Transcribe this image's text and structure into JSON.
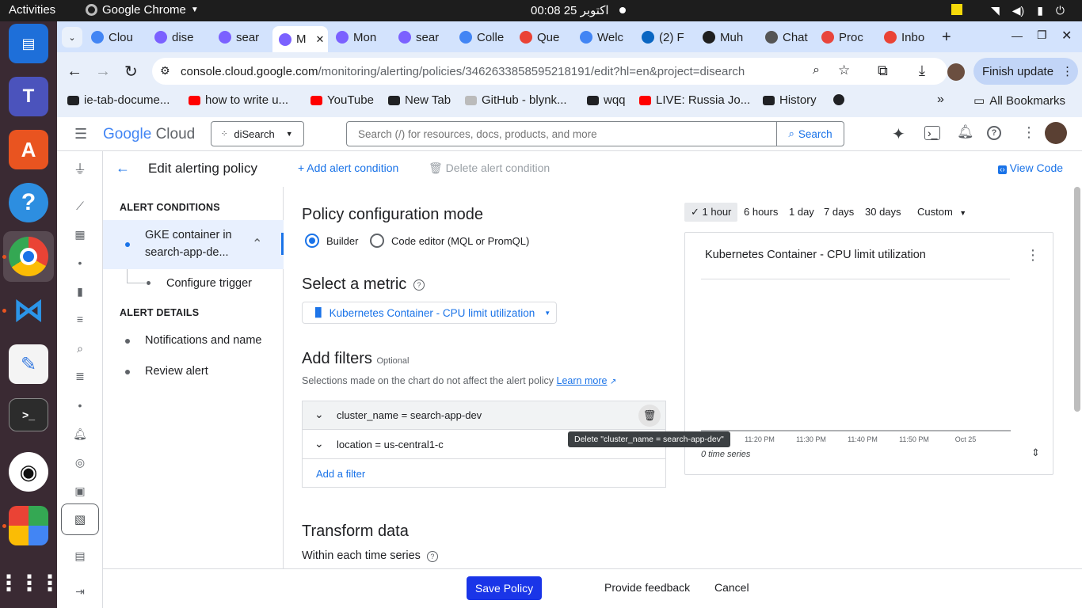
{
  "os": {
    "activities": "Activities",
    "app_name": "Google Chrome",
    "clock": "00:08  25 اکتوبر"
  },
  "browser": {
    "tabs": [
      {
        "label": "Clou",
        "color": "#4285f4"
      },
      {
        "label": "dise",
        "color": "#7b61ff"
      },
      {
        "label": "sear",
        "color": "#7b61ff"
      },
      {
        "label": "M",
        "color": "#7b61ff"
      },
      {
        "label": "Mon",
        "color": "#7b61ff"
      },
      {
        "label": "sear",
        "color": "#7b61ff"
      },
      {
        "label": "Colle",
        "color": "#4285f4"
      },
      {
        "label": "Que",
        "color": "#ea4335"
      },
      {
        "label": "Welc",
        "color": "#4285f4"
      },
      {
        "label": "(2) F",
        "color": "#0a66c2"
      },
      {
        "label": "Muh",
        "color": "#1f1f1f"
      },
      {
        "label": "Chat",
        "color": "#555555"
      },
      {
        "label": "Proc",
        "color": "#e8453c"
      },
      {
        "label": "Inbo",
        "color": "#ea4335"
      }
    ],
    "url_host": "console.cloud.google.com",
    "url_path": "/monitoring/alerting/policies/3462633858595218191/edit?hl=en&project=disearch",
    "finish_update": "Finish update",
    "bookmarks": [
      "ie-tab-docume...",
      "how to write u...",
      "YouTube",
      "New Tab",
      "GitHub - blynk...",
      "wqq",
      "LIVE: Russia Jo...",
      "History"
    ],
    "all_bookmarks": "All Bookmarks"
  },
  "gcp": {
    "logo_google": "Google",
    "logo_cloud": "Cloud",
    "project": "diSearch",
    "search_placeholder": "Search (/) for resources, docs, products, and more",
    "search_button": "Search"
  },
  "header": {
    "title": "Edit alerting policy",
    "add_condition": "Add alert condition",
    "delete_condition": "Delete alert condition",
    "view_code": "View Code"
  },
  "leftnav": {
    "alert_conditions": "ALERT CONDITIONS",
    "condition_line1": "GKE container in",
    "condition_line2": "search-app-de...",
    "configure_trigger": "Configure trigger",
    "alert_details": "ALERT DETAILS",
    "notifications": "Notifications and name",
    "review": "Review alert"
  },
  "main": {
    "mode_title": "Policy configuration mode",
    "builder": "Builder",
    "code_editor": "Code editor (MQL or PromQL)",
    "metric_title": "Select a metric",
    "metric_value": "Kubernetes Container - CPU limit utilization",
    "filters_title": "Add filters",
    "filters_optional": "Optional",
    "filters_note": "Selections made on the chart do not affect the alert policy",
    "learn_more": "Learn more",
    "filters": [
      "cluster_name = search-app-dev",
      "location = us-central1-c"
    ],
    "add_filter": "Add a filter",
    "tooltip": "Delete \"cluster_name = search-app-dev\"",
    "transform_title": "Transform data",
    "within_series": "Within each time series"
  },
  "chart": {
    "ranges": [
      "1 hour",
      "6 hours",
      "1 day",
      "7 days",
      "30 days",
      "Custom"
    ],
    "selected_range": "1 hour",
    "title": "Kubernetes Container - CPU limit utilization",
    "x_ticks": [
      "11:20 PM",
      "11:30 PM",
      "11:40 PM",
      "11:50 PM",
      "Oct 25"
    ],
    "series_count": "0 time series"
  },
  "chart_data": {
    "type": "line",
    "title": "Kubernetes Container - CPU limit utilization",
    "x": [
      "11:20 PM",
      "11:30 PM",
      "11:40 PM",
      "11:50 PM",
      "Oct 25"
    ],
    "series": [],
    "legend": "0 time series"
  },
  "footer": {
    "save": "Save Policy",
    "feedback": "Provide feedback",
    "cancel": "Cancel"
  }
}
